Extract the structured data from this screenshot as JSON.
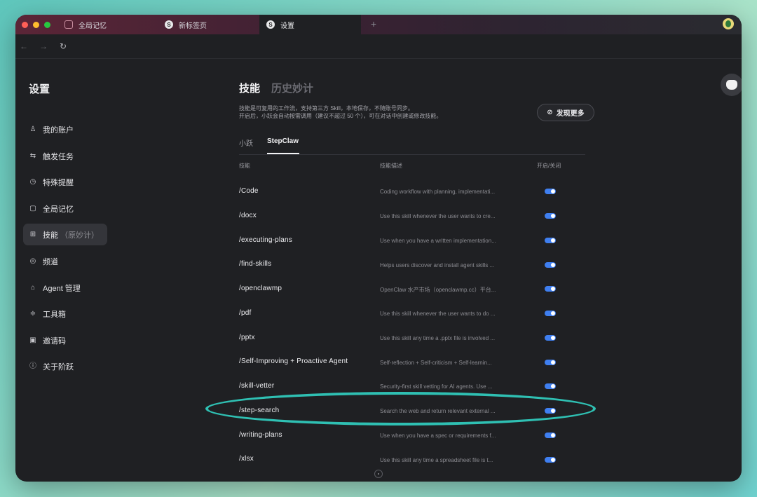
{
  "tabs": [
    {
      "label": "全局记忆",
      "icon": "memory-icon"
    },
    {
      "label": "新标签页",
      "icon": "stepfun-logo-icon"
    },
    {
      "label": "设置",
      "icon": "stepfun-logo-icon"
    }
  ],
  "nav": {
    "back": "←",
    "forward": "→",
    "reload": "↻",
    "new_tab": "+"
  },
  "sidebar": {
    "title": "设置",
    "items": [
      {
        "label": "我的账户",
        "icon": "user-icon",
        "glyph": "♙"
      },
      {
        "label": "触发任务",
        "icon": "trigger-task-icon",
        "glyph": "⇆"
      },
      {
        "label": "特殊提醒",
        "icon": "alarm-clock-icon",
        "glyph": "◷"
      },
      {
        "label": "全局记忆",
        "icon": "memory-icon",
        "glyph": "▢"
      },
      {
        "label": "技能",
        "sub": "（原妙计）",
        "icon": "skills-grid-icon",
        "glyph": "⊞",
        "active": true
      },
      {
        "label": "频道",
        "icon": "channel-icon",
        "glyph": "◎"
      },
      {
        "label": "Agent 管理",
        "icon": "agent-manage-icon",
        "glyph": "⌂"
      },
      {
        "label": "工具箱",
        "icon": "toolbox-icon",
        "glyph": "≑"
      },
      {
        "label": "邀请码",
        "icon": "invite-code-icon",
        "glyph": "▣"
      },
      {
        "label": "关于阶跃",
        "icon": "info-icon",
        "glyph": "ⓘ"
      }
    ]
  },
  "main": {
    "tab_skills": "技能",
    "tab_history": "历史妙计",
    "desc_line1": "技能是可复用的工作流，支持第三方 Skill，本地保存，不随账号同步。",
    "desc_line2": "开启后，小跃会自动按需调用（建议不超过 50 个），可在对话中创建或修改技能。",
    "discover_button": "发现更多",
    "sub_tabs": [
      "小跃",
      "StepClaw"
    ],
    "columns": [
      "技能",
      "技能描述",
      "开启/关闭"
    ],
    "rows": [
      {
        "name": "/Code",
        "desc": "Coding workflow with planning, implementati...",
        "enabled": true
      },
      {
        "name": "/docx",
        "desc": "Use this skill whenever the user wants to cre...",
        "enabled": true
      },
      {
        "name": "/executing-plans",
        "desc": "Use when you have a written implementation...",
        "enabled": true
      },
      {
        "name": "/find-skills",
        "desc": "Helps users discover and install agent skills ...",
        "enabled": true
      },
      {
        "name": "/openclawmp",
        "desc": "OpenClaw 水产市场（openclawmp.cc）平台...",
        "enabled": true
      },
      {
        "name": "/pdf",
        "desc": "Use this skill whenever the user wants to do ...",
        "enabled": true
      },
      {
        "name": "/pptx",
        "desc": "Use this skill any time a .pptx file is involved ...",
        "enabled": true
      },
      {
        "name": "/Self-Improving + Proactive Agent",
        "desc": "Self-reflection + Self-criticism + Self-learnin...",
        "enabled": true
      },
      {
        "name": "/skill-vetter",
        "desc": "Security-first skill vetting for AI agents. Use ...",
        "enabled": true
      },
      {
        "name": "/step-search",
        "desc": "Search the web and return relevant external ...",
        "enabled": true
      },
      {
        "name": "/writing-plans",
        "desc": "Use when you have a spec or requirements f...",
        "enabled": true
      },
      {
        "name": "/xlsx",
        "desc": "Use this skill any time a spreadsheet file is t...",
        "enabled": true
      }
    ]
  },
  "colors": {
    "toggle_on": "#3f7ff0",
    "highlight_ring": "#2fc0b3"
  }
}
